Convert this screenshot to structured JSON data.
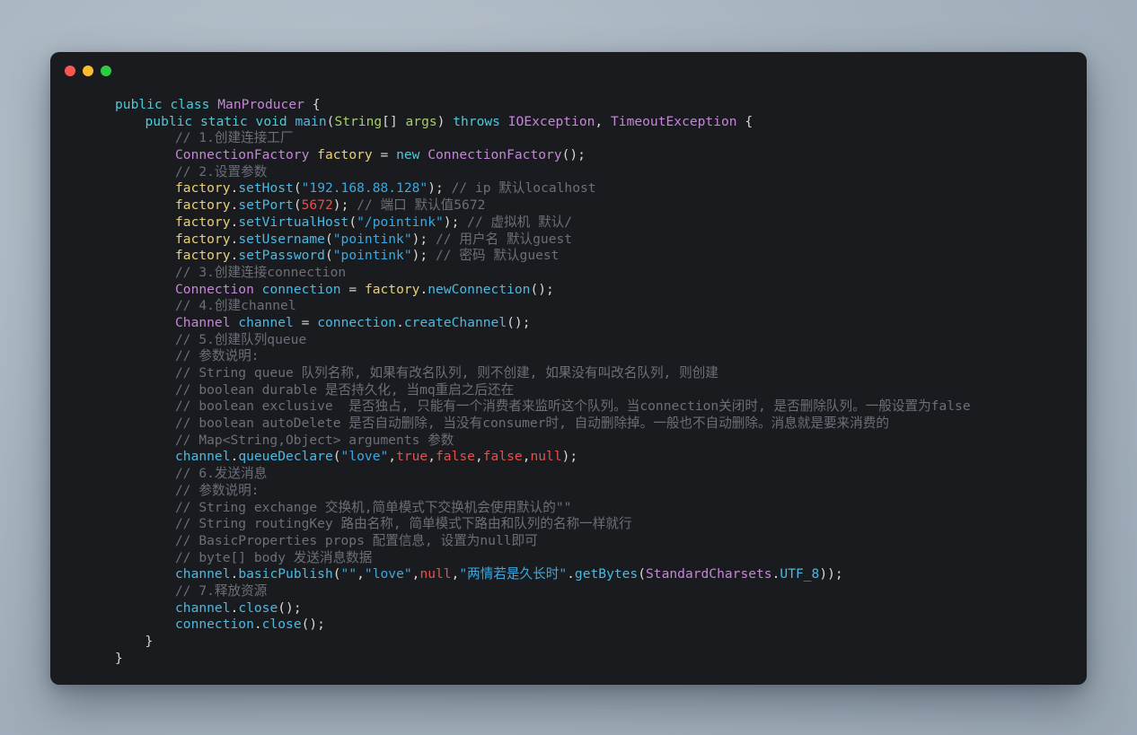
{
  "window": {
    "title": "",
    "traffic_lights": [
      {
        "name": "close-button",
        "color": "#f9574f"
      },
      {
        "name": "minimize-button",
        "color": "#f9bd2f"
      },
      {
        "name": "maximize-button",
        "color": "#2ecc40"
      }
    ]
  },
  "theme": {
    "background": "#1a1b1e",
    "desktop": "#a8b4c0",
    "keyword": "#4ec9d8",
    "type": "#c586d8",
    "string": "#3da8e0",
    "comment": "#6a6f78",
    "number": "#e05252",
    "literal": "#e05252",
    "identifier": "#4fb8e0",
    "variable": "#e8d07a",
    "punctuation": "#d8d8d8"
  },
  "code": {
    "language": "java",
    "class_name": "ManProducer",
    "lines": [
      {
        "indent": 0,
        "tokens": [
          {
            "t": "public",
            "c": "kw"
          },
          {
            "t": " ",
            "c": "plain"
          },
          {
            "t": "class",
            "c": "kw"
          },
          {
            "t": " ",
            "c": "plain"
          },
          {
            "t": "ManProducer",
            "c": "type"
          },
          {
            "t": " ",
            "c": "plain"
          },
          {
            "t": "{",
            "c": "punc"
          }
        ]
      },
      {
        "indent": 1,
        "tokens": [
          {
            "t": "public",
            "c": "kw"
          },
          {
            "t": " ",
            "c": "plain"
          },
          {
            "t": "static",
            "c": "kw"
          },
          {
            "t": " ",
            "c": "plain"
          },
          {
            "t": "void",
            "c": "kw"
          },
          {
            "t": " ",
            "c": "plain"
          },
          {
            "t": "main",
            "c": "ident"
          },
          {
            "t": "(",
            "c": "punc"
          },
          {
            "t": "String",
            "c": "greenid"
          },
          {
            "t": "[] ",
            "c": "punc"
          },
          {
            "t": "args",
            "c": "greenid"
          },
          {
            "t": ") ",
            "c": "punc"
          },
          {
            "t": "throws",
            "c": "kw"
          },
          {
            "t": " ",
            "c": "plain"
          },
          {
            "t": "IOException",
            "c": "type"
          },
          {
            "t": ", ",
            "c": "punc"
          },
          {
            "t": "TimeoutException",
            "c": "type"
          },
          {
            "t": " ",
            "c": "plain"
          },
          {
            "t": "{",
            "c": "punc"
          }
        ]
      },
      {
        "indent": 2,
        "tokens": [
          {
            "t": "// 1.创建连接工厂",
            "c": "cmt"
          }
        ]
      },
      {
        "indent": 2,
        "tokens": [
          {
            "t": "ConnectionFactory",
            "c": "type"
          },
          {
            "t": " ",
            "c": "plain"
          },
          {
            "t": "factory",
            "c": "var"
          },
          {
            "t": " ",
            "c": "plain"
          },
          {
            "t": "=",
            "c": "punc"
          },
          {
            "t": " ",
            "c": "plain"
          },
          {
            "t": "new",
            "c": "kw"
          },
          {
            "t": " ",
            "c": "plain"
          },
          {
            "t": "ConnectionFactory",
            "c": "type"
          },
          {
            "t": "();",
            "c": "punc"
          }
        ]
      },
      {
        "indent": 2,
        "tokens": [
          {
            "t": "// 2.设置参数",
            "c": "cmt"
          }
        ]
      },
      {
        "indent": 2,
        "tokens": [
          {
            "t": "factory",
            "c": "var"
          },
          {
            "t": ".",
            "c": "punc"
          },
          {
            "t": "setHost",
            "c": "ident"
          },
          {
            "t": "(",
            "c": "punc"
          },
          {
            "t": "\"192.168.88.128\"",
            "c": "str"
          },
          {
            "t": ");",
            "c": "punc"
          },
          {
            "t": " ",
            "c": "plain"
          },
          {
            "t": "// ip 默认localhost",
            "c": "cmt"
          }
        ]
      },
      {
        "indent": 2,
        "tokens": [
          {
            "t": "factory",
            "c": "var"
          },
          {
            "t": ".",
            "c": "punc"
          },
          {
            "t": "setPort",
            "c": "ident"
          },
          {
            "t": "(",
            "c": "punc"
          },
          {
            "t": "5672",
            "c": "num"
          },
          {
            "t": ");",
            "c": "punc"
          },
          {
            "t": " ",
            "c": "plain"
          },
          {
            "t": "// 端口 默认值5672",
            "c": "cmt"
          }
        ]
      },
      {
        "indent": 2,
        "tokens": [
          {
            "t": "factory",
            "c": "var"
          },
          {
            "t": ".",
            "c": "punc"
          },
          {
            "t": "setVirtualHost",
            "c": "ident"
          },
          {
            "t": "(",
            "c": "punc"
          },
          {
            "t": "\"/pointink\"",
            "c": "str"
          },
          {
            "t": ");",
            "c": "punc"
          },
          {
            "t": " ",
            "c": "plain"
          },
          {
            "t": "// 虚拟机 默认/",
            "c": "cmt"
          }
        ]
      },
      {
        "indent": 2,
        "tokens": [
          {
            "t": "factory",
            "c": "var"
          },
          {
            "t": ".",
            "c": "punc"
          },
          {
            "t": "setUsername",
            "c": "ident"
          },
          {
            "t": "(",
            "c": "punc"
          },
          {
            "t": "\"pointink\"",
            "c": "str"
          },
          {
            "t": ");",
            "c": "punc"
          },
          {
            "t": " ",
            "c": "plain"
          },
          {
            "t": "// 用户名 默认guest",
            "c": "cmt"
          }
        ]
      },
      {
        "indent": 2,
        "tokens": [
          {
            "t": "factory",
            "c": "var"
          },
          {
            "t": ".",
            "c": "punc"
          },
          {
            "t": "setPassword",
            "c": "ident"
          },
          {
            "t": "(",
            "c": "punc"
          },
          {
            "t": "\"pointink\"",
            "c": "str"
          },
          {
            "t": ");",
            "c": "punc"
          },
          {
            "t": " ",
            "c": "plain"
          },
          {
            "t": "// 密码 默认guest",
            "c": "cmt"
          }
        ]
      },
      {
        "indent": 2,
        "tokens": [
          {
            "t": "// 3.创建连接connection",
            "c": "cmt"
          }
        ]
      },
      {
        "indent": 2,
        "tokens": [
          {
            "t": "Connection",
            "c": "type"
          },
          {
            "t": " ",
            "c": "plain"
          },
          {
            "t": "connection",
            "c": "ident"
          },
          {
            "t": " ",
            "c": "plain"
          },
          {
            "t": "=",
            "c": "punc"
          },
          {
            "t": " ",
            "c": "plain"
          },
          {
            "t": "factory",
            "c": "var"
          },
          {
            "t": ".",
            "c": "punc"
          },
          {
            "t": "newConnection",
            "c": "ident"
          },
          {
            "t": "();",
            "c": "punc"
          }
        ]
      },
      {
        "indent": 2,
        "tokens": [
          {
            "t": "// 4.创建channel",
            "c": "cmt"
          }
        ]
      },
      {
        "indent": 2,
        "tokens": [
          {
            "t": "Channel",
            "c": "type"
          },
          {
            "t": " ",
            "c": "plain"
          },
          {
            "t": "channel",
            "c": "ident"
          },
          {
            "t": " ",
            "c": "plain"
          },
          {
            "t": "=",
            "c": "punc"
          },
          {
            "t": " ",
            "c": "plain"
          },
          {
            "t": "connection",
            "c": "ident"
          },
          {
            "t": ".",
            "c": "punc"
          },
          {
            "t": "createChannel",
            "c": "ident"
          },
          {
            "t": "();",
            "c": "punc"
          }
        ]
      },
      {
        "indent": 2,
        "tokens": [
          {
            "t": "// 5.创建队列queue",
            "c": "cmt"
          }
        ]
      },
      {
        "indent": 2,
        "tokens": [
          {
            "t": "// 参数说明:",
            "c": "cmt"
          }
        ]
      },
      {
        "indent": 2,
        "tokens": [
          {
            "t": "// String queue 队列名称, 如果有改名队列, 则不创建, 如果没有叫改名队列, 则创建",
            "c": "cmt"
          }
        ]
      },
      {
        "indent": 2,
        "tokens": [
          {
            "t": "// boolean durable 是否持久化, 当mq重启之后还在",
            "c": "cmt"
          }
        ]
      },
      {
        "indent": 2,
        "tokens": [
          {
            "t": "// boolean exclusive  是否独占, 只能有一个消费者来监听这个队列。当connection关闭时, 是否删除队列。一般设置为false",
            "c": "cmt"
          }
        ]
      },
      {
        "indent": 2,
        "tokens": [
          {
            "t": "// boolean autoDelete 是否自动删除, 当没有consumer时, 自动删除掉。一般也不自动删除。消息就是要来消费的",
            "c": "cmt"
          }
        ]
      },
      {
        "indent": 2,
        "tokens": [
          {
            "t": "// Map<String,Object> arguments 参数",
            "c": "cmt"
          }
        ]
      },
      {
        "indent": 2,
        "tokens": [
          {
            "t": "channel",
            "c": "ident"
          },
          {
            "t": ".",
            "c": "punc"
          },
          {
            "t": "queueDeclare",
            "c": "ident"
          },
          {
            "t": "(",
            "c": "punc"
          },
          {
            "t": "\"love\"",
            "c": "str"
          },
          {
            "t": ",",
            "c": "punc"
          },
          {
            "t": "true",
            "c": "lit"
          },
          {
            "t": ",",
            "c": "punc"
          },
          {
            "t": "false",
            "c": "lit"
          },
          {
            "t": ",",
            "c": "punc"
          },
          {
            "t": "false",
            "c": "lit"
          },
          {
            "t": ",",
            "c": "punc"
          },
          {
            "t": "null",
            "c": "lit"
          },
          {
            "t": ");",
            "c": "punc"
          }
        ]
      },
      {
        "indent": 2,
        "tokens": [
          {
            "t": "// 6.发送消息",
            "c": "cmt"
          }
        ]
      },
      {
        "indent": 2,
        "tokens": [
          {
            "t": "// 参数说明:",
            "c": "cmt"
          }
        ]
      },
      {
        "indent": 2,
        "tokens": [
          {
            "t": "// String exchange 交换机,简单模式下交换机会使用默认的\"\"",
            "c": "cmt"
          }
        ]
      },
      {
        "indent": 2,
        "tokens": [
          {
            "t": "// String routingKey 路由名称, 简单模式下路由和队列的名称一样就行",
            "c": "cmt"
          }
        ]
      },
      {
        "indent": 2,
        "tokens": [
          {
            "t": "// BasicProperties props 配置信息, 设置为null即可",
            "c": "cmt"
          }
        ]
      },
      {
        "indent": 2,
        "tokens": [
          {
            "t": "// byte[] body 发送消息数据",
            "c": "cmt"
          }
        ]
      },
      {
        "indent": 2,
        "tokens": [
          {
            "t": "channel",
            "c": "ident"
          },
          {
            "t": ".",
            "c": "punc"
          },
          {
            "t": "basicPublish",
            "c": "ident"
          },
          {
            "t": "(",
            "c": "punc"
          },
          {
            "t": "\"\"",
            "c": "str"
          },
          {
            "t": ",",
            "c": "punc"
          },
          {
            "t": "\"love\"",
            "c": "str"
          },
          {
            "t": ",",
            "c": "punc"
          },
          {
            "t": "null",
            "c": "lit"
          },
          {
            "t": ",",
            "c": "punc"
          },
          {
            "t": "\"两情若是久长时\"",
            "c": "str"
          },
          {
            "t": ".",
            "c": "punc"
          },
          {
            "t": "getBytes",
            "c": "ident"
          },
          {
            "t": "(",
            "c": "punc"
          },
          {
            "t": "StandardCharsets",
            "c": "type"
          },
          {
            "t": ".",
            "c": "punc"
          },
          {
            "t": "UTF_8",
            "c": "ident"
          },
          {
            "t": "));",
            "c": "punc"
          }
        ]
      },
      {
        "indent": 2,
        "tokens": [
          {
            "t": "// 7.释放资源",
            "c": "cmt"
          }
        ]
      },
      {
        "indent": 2,
        "tokens": [
          {
            "t": "channel",
            "c": "ident"
          },
          {
            "t": ".",
            "c": "punc"
          },
          {
            "t": "close",
            "c": "ident"
          },
          {
            "t": "();",
            "c": "punc"
          }
        ]
      },
      {
        "indent": 2,
        "tokens": [
          {
            "t": "connection",
            "c": "ident"
          },
          {
            "t": ".",
            "c": "punc"
          },
          {
            "t": "close",
            "c": "ident"
          },
          {
            "t": "();",
            "c": "punc"
          }
        ]
      },
      {
        "indent": 1,
        "tokens": [
          {
            "t": "}",
            "c": "punc"
          }
        ]
      },
      {
        "indent": 0,
        "tokens": [
          {
            "t": "}",
            "c": "punc"
          }
        ]
      }
    ]
  }
}
